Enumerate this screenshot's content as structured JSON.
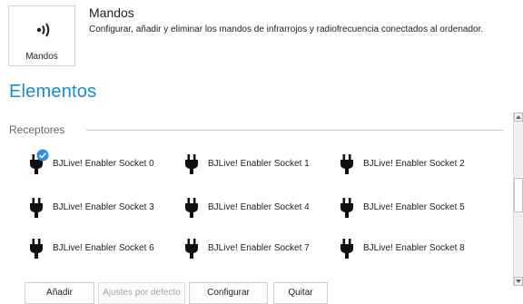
{
  "header": {
    "tile_label": "Mandos",
    "title": "Mandos",
    "description": "Configurar, añadir y eliminar los mandos de infrarrojos y radiofrecuencia conectados al ordenador.",
    "tile_icon": "remote-signal-icon"
  },
  "section": {
    "title": "Elementos",
    "group_label": "Receptores"
  },
  "items": [
    {
      "label": "BJLive! Enabler Socket 0",
      "selected": true,
      "icon": "plug-icon"
    },
    {
      "label": "BJLive! Enabler Socket 1",
      "icon": "plug-icon"
    },
    {
      "label": "BJLive! Enabler Socket 2",
      "icon": "plug-icon"
    },
    {
      "label": "BJLive! Enabler Socket 3",
      "icon": "plug-icon"
    },
    {
      "label": "BJLive! Enabler Socket 4",
      "icon": "plug-icon"
    },
    {
      "label": "BJLive! Enabler Socket 5",
      "icon": "plug-icon"
    },
    {
      "label": "BJLive! Enabler Socket 6",
      "icon": "plug-icon"
    },
    {
      "label": "BJLive! Enabler Socket 7",
      "icon": "plug-icon"
    },
    {
      "label": "BJLive! Enabler Socket 8",
      "icon": "plug-icon"
    }
  ],
  "buttons": {
    "add": "Añadir",
    "defaults": "Ajustes por defecto",
    "configure": "Configurar",
    "remove": "Quitar"
  },
  "colors": {
    "accent": "#1a8ad4",
    "check": "#2f8ee0"
  }
}
